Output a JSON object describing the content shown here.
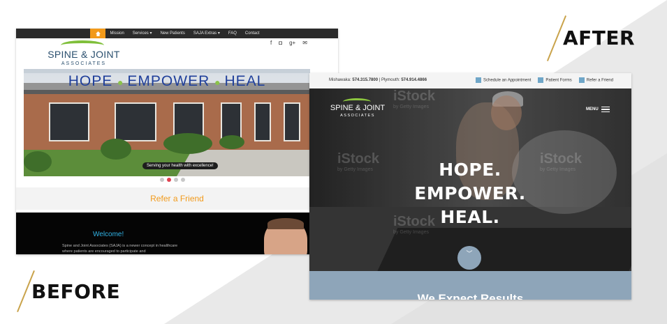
{
  "labels": {
    "after": "AFTER",
    "before": "BEFORE"
  },
  "colors": {
    "accent_gold": "#c9a34b",
    "before_orange": "#f29a1a",
    "after_blue": "#8ea5b9",
    "logo_green": "#7fbf3a"
  },
  "before": {
    "nav": {
      "home_icon": "home-icon",
      "items": [
        "Mission",
        "Services ▾",
        "New Patients",
        "SAJA Extras ▾",
        "FAQ",
        "Contact"
      ]
    },
    "logo": {
      "name": "SPINE & JOINT",
      "sub": "ASSOCIATES"
    },
    "social_icons": [
      "facebook-icon",
      "instagram-icon",
      "googleplus-icon",
      "email-icon"
    ],
    "hero": {
      "words": [
        "HOPE",
        "EMPOWER",
        "HEAL"
      ],
      "caption": "Serving your health with excellence!"
    },
    "carousel": {
      "count": 4,
      "active_index": 1
    },
    "refer_label": "Refer a Friend",
    "welcome": {
      "title": "Welcome!",
      "text": "Spine and Joint Associates (SAJA) is a newer concept in healthcare where patients are encouraged to participate and"
    }
  },
  "after": {
    "topbar": {
      "loc1_label": "Mishawaka:",
      "loc1_phone": "574.315.7800",
      "separator": "|",
      "loc2_label": "Plymouth:",
      "loc2_phone": "574.914.4866",
      "links": [
        {
          "icon": "calendar-icon",
          "label": "Schedule an Appointment"
        },
        {
          "icon": "forms-icon",
          "label": "Patient Forms"
        },
        {
          "icon": "people-icon",
          "label": "Refer a Friend"
        }
      ]
    },
    "logo": {
      "name": "SPINE & JOINT",
      "sub": "ASSOCIATES"
    },
    "menu_label": "MENU",
    "headline": [
      "HOPE.",
      "EMPOWER.",
      "HEAL."
    ],
    "watermark": {
      "brand": "iStock",
      "by": "by Getty Images"
    },
    "chevron_icon": "chevron-down-icon",
    "section_title": "We Expect Results"
  }
}
